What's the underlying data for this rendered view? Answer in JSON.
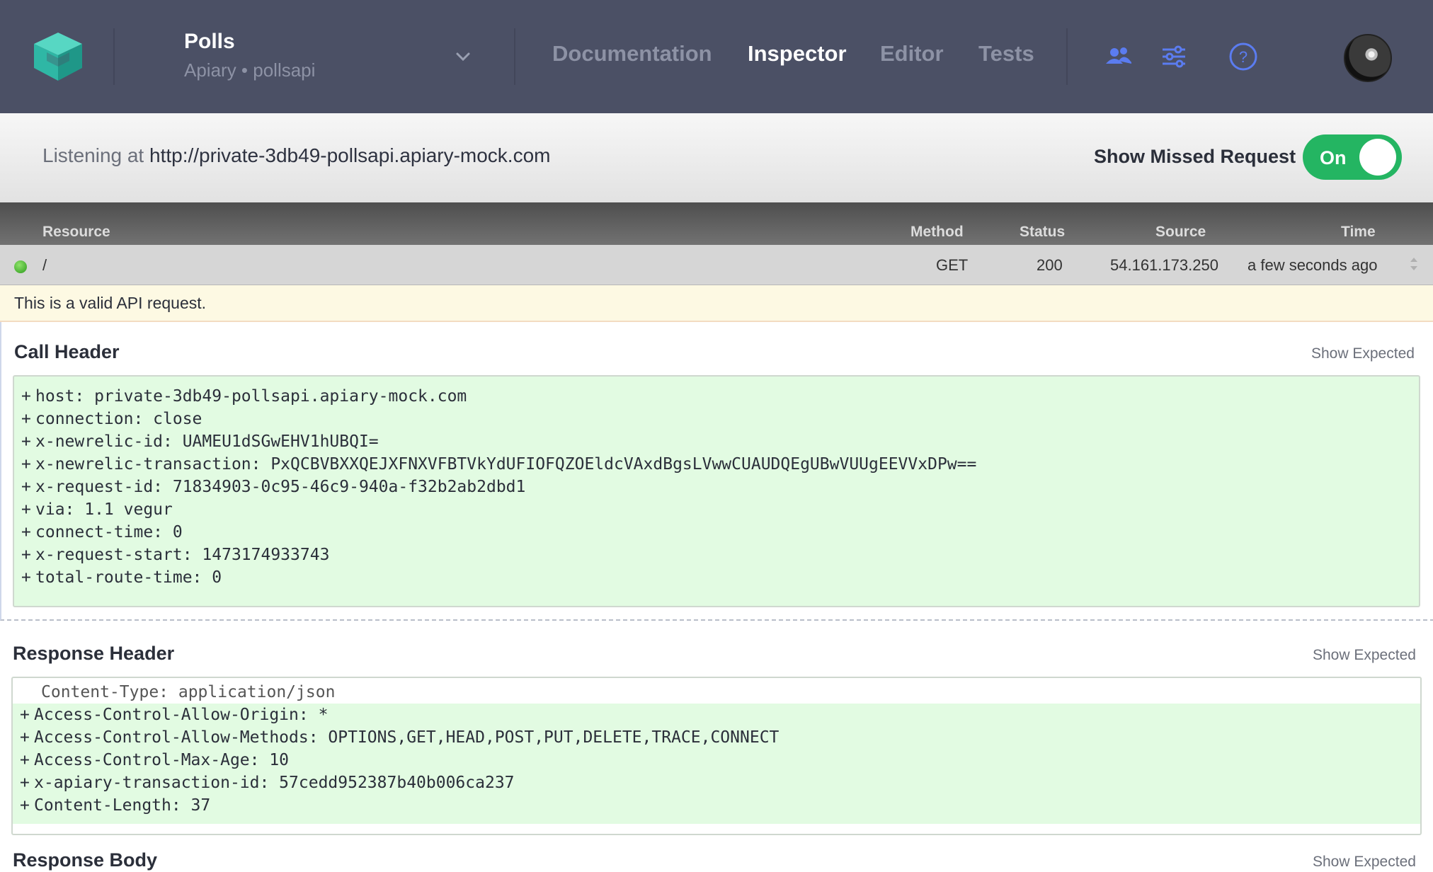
{
  "header": {
    "project_name": "Polls",
    "project_sub": "Apiary • pollsapi",
    "nav": [
      "Documentation",
      "Inspector",
      "Editor",
      "Tests"
    ],
    "active_nav": "Inspector",
    "icons": [
      "apiary-logo-icon",
      "team-icon",
      "settings-sliders-icon",
      "help-icon",
      "user-avatar"
    ]
  },
  "listening": {
    "prefix": "Listening at ",
    "url": "http://private-3db49-pollsapi.apiary-mock.com",
    "missed_label": "Show Missed Request",
    "toggle_label": "On"
  },
  "table": {
    "columns": [
      "Resource",
      "Method",
      "Status",
      "Source",
      "Time"
    ],
    "row": {
      "resource": "/",
      "method": "GET",
      "status": "200",
      "source": "54.161.173.250",
      "time": "a few seconds ago"
    }
  },
  "notice": "This is a valid API request.",
  "call_header": {
    "title": "Call Header",
    "show_expected": "Show Expected",
    "lines": [
      "host: private-3db49-pollsapi.apiary-mock.com",
      "connection: close",
      "x-newrelic-id: UAMEU1dSGwEHV1hUBQI=",
      "x-newrelic-transaction: PxQCBVBXXQEJXFNXVFBTVkYdUFIOFQZOEldcVAxdBgsLVwwCUAUDQEgUBwVUUgEEVVxDPw==",
      "x-request-id: 71834903-0c95-46c9-940a-f32b2ab2dbd1",
      "via: 1.1 vegur",
      "connect-time: 0",
      "x-request-start: 1473174933743",
      "total-route-time: 0"
    ]
  },
  "response_header": {
    "title": "Response Header",
    "show_expected": "Show Expected",
    "neutral_line": "Content-Type: application/json",
    "lines": [
      "Access-Control-Allow-Origin: *",
      "Access-Control-Allow-Methods: OPTIONS,GET,HEAD,POST,PUT,DELETE,TRACE,CONNECT",
      "Access-Control-Max-Age: 10",
      "x-apiary-transaction-id: 57cedd952387b40b006ca237",
      "Content-Length: 37"
    ]
  },
  "response_body": {
    "title": "Response Body",
    "show_expected": "Show Expected"
  },
  "colors": {
    "topbar": "#4b5065",
    "toggle_on": "#24b562",
    "diff_added_bg": "#e2fbe2",
    "notice_bg": "#fdf9e3",
    "icon_accent": "#5b7cf0"
  }
}
